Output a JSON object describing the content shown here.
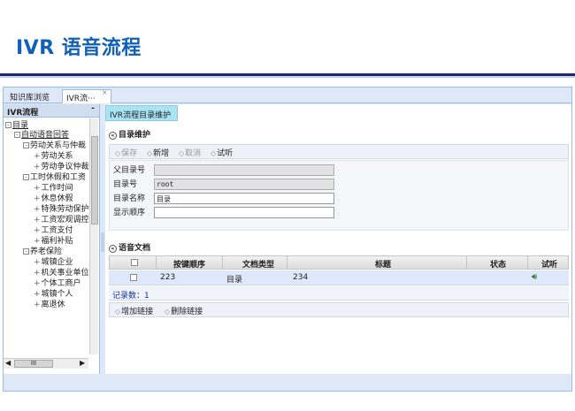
{
  "slide": {
    "title": "IVR 语音流程"
  },
  "tabs": [
    {
      "label": "知识库浏览"
    },
    {
      "label": "IVR流···",
      "close": "×"
    }
  ],
  "left_panel": {
    "title": "IVR流程",
    "collapse": "-",
    "tree": [
      {
        "label": "目录",
        "expander": "-"
      },
      {
        "label": "自动语音回答",
        "expander": "-"
      },
      {
        "label": "劳动关系与仲裁",
        "expander": "-"
      },
      {
        "label": "劳动关系"
      },
      {
        "label": "劳动争议仲裁"
      },
      {
        "label": "工时休假和工资",
        "expander": "-"
      },
      {
        "label": "工作时间"
      },
      {
        "label": "休息休假"
      },
      {
        "label": "特殊劳动保护"
      },
      {
        "label": "工资宏观调控"
      },
      {
        "label": "工资支付"
      },
      {
        "label": "福利补贴"
      },
      {
        "label": "养老保险",
        "expander": "-"
      },
      {
        "label": "城镇企业"
      },
      {
        "label": "机关事业单位"
      },
      {
        "label": "个体工商户"
      },
      {
        "label": "城镇个人"
      },
      {
        "label": "离退休"
      }
    ],
    "hscroll_label": "III",
    "hscroll_left": "◀",
    "hscroll_right": "▶"
  },
  "right_panel": {
    "tab_label": "IVR流程目录维护",
    "catalog_section": "目录维护",
    "toolbar": {
      "save": "保存",
      "add": "新增",
      "cancel": "取消",
      "listen": "试听"
    },
    "form": {
      "parent_label": "父目录号",
      "parent_value": "",
      "id_label": "目录号",
      "id_value": "root",
      "name_label": "目录名称",
      "name_value": "目录",
      "order_label": "显示顺序",
      "order_value": ""
    },
    "voice_section": "语音文档",
    "grid": {
      "columns": {
        "key_order": "按键顺序",
        "doc_type": "文档类型",
        "title": "标题",
        "status": "状态",
        "listen": "试听"
      },
      "rows": [
        {
          "key_order": "223",
          "doc_type": "目录",
          "title": "234",
          "status": "",
          "listen_icon": "speaker-icon"
        }
      ],
      "record_count": "记录数：1"
    },
    "link_toolbar": {
      "add_link": "增加链接",
      "delete_link": "删除链接"
    }
  },
  "colors": {
    "title_blue": "#1060b8",
    "rule": "#1a2a7a",
    "panel_bg": "#dfe8f6",
    "tab_active": "#a8e4f4"
  }
}
